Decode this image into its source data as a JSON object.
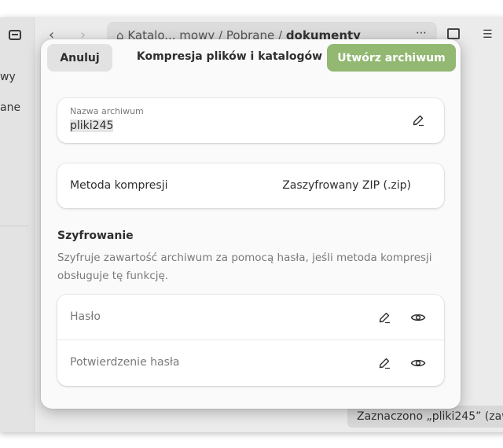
{
  "background": {
    "sidebar_items": [
      "wy",
      "ane"
    ],
    "path": {
      "segments": [
        "Katalo... mowy",
        "Pobrane"
      ],
      "separator": "/",
      "current": "dokumenty"
    },
    "status_text": "Zaznaczono „pliki245” (zaw"
  },
  "dialog": {
    "cancel_label": "Anuluj",
    "title": "Kompresja plików i katalogów",
    "create_label": "Utwórz archiwum",
    "archive_name": {
      "label": "Nazwa archiwum",
      "value": "pliki245"
    },
    "compression": {
      "label": "Metoda kompresji",
      "value": "Zaszyfrowany ZIP (.zip)"
    },
    "encryption": {
      "title": "Szyfrowanie",
      "description": "Szyfruje zawartość archiwum za pomocą hasła, jeśli metoda kompresji obsługuje tę funkcję.",
      "password_placeholder": "Hasło",
      "confirm_placeholder": "Potwierdzenie hasła"
    }
  },
  "colors": {
    "accent": "#92b872",
    "dialog_bg": "#fafafa",
    "card_bg": "#ffffff",
    "window_bg": "#ebebeb"
  },
  "icons": [
    "back-arrow-icon",
    "forward-arrow-icon",
    "home-icon",
    "edit-pencil-icon",
    "eye-icon",
    "search-folder-icon",
    "list-view-icon"
  ]
}
